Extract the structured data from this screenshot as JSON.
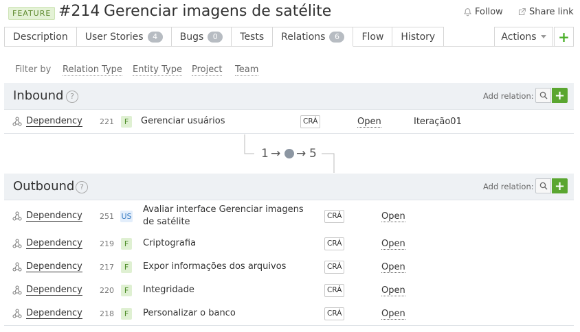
{
  "header": {
    "badge": "FEATURE",
    "id": "#214",
    "title": "Gerenciar imagens de satélite",
    "follow_label": "Follow",
    "share_label": "Share link"
  },
  "tabs": [
    {
      "label": "Description"
    },
    {
      "label": "User Stories",
      "count": "4"
    },
    {
      "label": "Bugs",
      "count": "0"
    },
    {
      "label": "Tests"
    },
    {
      "label": "Relations",
      "count": "6"
    },
    {
      "label": "Flow"
    },
    {
      "label": "History"
    }
  ],
  "toolbar": {
    "actions_label": "Actions",
    "add_label": "+"
  },
  "filter": {
    "label": "Filter by",
    "options": [
      "Relation Type",
      "Entity Type",
      "Project",
      "Team"
    ]
  },
  "inbound": {
    "title": "Inbound",
    "add_relation_label": "Add relation:",
    "rows": [
      {
        "relation": "Dependency",
        "id": "221",
        "type": "F",
        "name": "Gerenciar usuários",
        "state_badge": "CRÁ",
        "state": "Open",
        "iteration": "Iteração01"
      }
    ]
  },
  "connector": {
    "left": "1",
    "arrow": "→",
    "right": "5"
  },
  "outbound": {
    "title": "Outbound",
    "add_relation_label": "Add relation:",
    "rows": [
      {
        "relation": "Dependency",
        "id": "251",
        "type": "US",
        "name": "Avaliar interface Gerenciar imagens de satélite",
        "state_badge": "CRÁ",
        "state": "Open"
      },
      {
        "relation": "Dependency",
        "id": "219",
        "type": "F",
        "name": "Criptografia",
        "state_badge": "CRÁ",
        "state": "Open"
      },
      {
        "relation": "Dependency",
        "id": "217",
        "type": "F",
        "name": "Expor informações dos arquivos",
        "state_badge": "CRÁ",
        "state": "Open"
      },
      {
        "relation": "Dependency",
        "id": "220",
        "type": "F",
        "name": "Integridade",
        "state_badge": "CRÁ",
        "state": "Open"
      },
      {
        "relation": "Dependency",
        "id": "218",
        "type": "F",
        "name": "Personalizar o banco",
        "state_badge": "CRÁ",
        "state": "Open"
      }
    ]
  },
  "colors": {
    "accent_green": "#5aa630",
    "feature_badge_bg": "#e4f2d6",
    "section_bg": "#eef1f4"
  },
  "icons": [
    "bell-icon",
    "share-icon",
    "chevron-down-icon",
    "help-icon",
    "search-icon",
    "plus-icon",
    "relation-icon"
  ]
}
